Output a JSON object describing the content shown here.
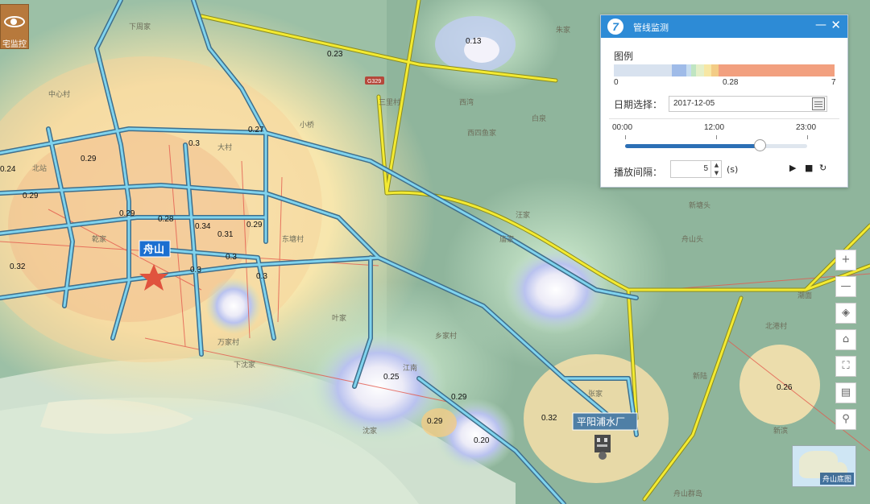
{
  "logo": {
    "text": "宅监控"
  },
  "map": {
    "city_label": "舟山",
    "plant_label": "平阳浦水厂",
    "highway_badge": "G329",
    "readings": [
      "0.13",
      "0.23",
      "0.27",
      "0.29",
      "0.3",
      "0.29",
      "0.24",
      "0.29",
      "0.28",
      "0.34",
      "0.31",
      "0.29",
      "0.3",
      "0.3",
      "0.3",
      "0.32",
      "0.25",
      "0.29",
      "0.29",
      "0.20",
      "0.32",
      "0.26"
    ],
    "places": [
      "中心村",
      "大村",
      "西四鱼家",
      "小桥",
      "北站",
      "乾家",
      "万家村",
      "下沈家",
      "叶家",
      "沈家",
      "江南",
      "舟山头",
      "新塘头",
      "张家",
      "新滨",
      "庙家",
      "新陆",
      "舟山群岛",
      "汪家",
      "朱家",
      "三里村",
      "乡家村",
      "北港村",
      "东塘村",
      "下周家",
      "西湾",
      "白泉",
      "潮面"
    ]
  },
  "panel": {
    "title": "管线监测",
    "min_icon": "minimize-icon",
    "close_icon": "close-icon",
    "legend_title": "图例",
    "legend_min": "0",
    "legend_mid": "0.28",
    "legend_max": "7",
    "legend_colors": [
      "#d8e2ef",
      "#d8e2ef",
      "#9fbbe8",
      "#c6dcf0",
      "#bfe5c2",
      "#e4efc8",
      "#f7e7a4",
      "#f3cc86",
      "#f2a07f",
      "#f2a07f",
      "#f2a07f"
    ],
    "date_label": "日期选择：",
    "date_value": "2017-12-05",
    "time_start": "00:00",
    "time_mid": "12:00",
    "time_end": "23:00",
    "slider_progress": 0.74,
    "interval_label": "播放间隔：",
    "interval_value": "5",
    "interval_unit": "(s)",
    "play_icon": "▶",
    "stop_icon": "■",
    "refresh_icon": "↻"
  },
  "toolbar": {
    "zoom_in": "+",
    "zoom_out": "—",
    "layers": "◈",
    "home": "⌂",
    "fullscreen": "⛶",
    "measure": "▤",
    "search": "⚲"
  },
  "overview": {
    "label": "舟山底图"
  }
}
